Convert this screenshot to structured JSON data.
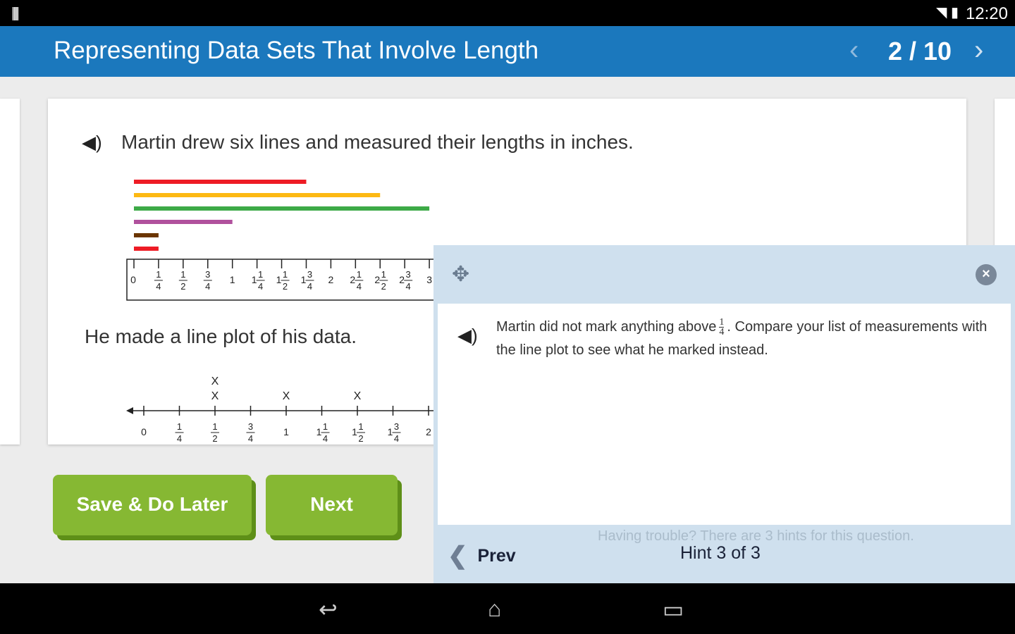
{
  "status": {
    "time": "12:20"
  },
  "header": {
    "title": "Representing Data Sets That Involve Length",
    "pager": "2 / 10"
  },
  "question": {
    "text": "Martin drew six lines and measured their lengths in inches.",
    "plot_text": "He made a line plot of his data."
  },
  "lines": [
    {
      "color": "#ee1c25",
      "length": 1.75
    },
    {
      "color": "#fdb913",
      "length": 2.5
    },
    {
      "color": "#3daa47",
      "length": 3
    },
    {
      "color": "#b0519d",
      "length": 1
    },
    {
      "color": "#6b3500",
      "length": 0.25
    },
    {
      "color": "#ee1c25",
      "length": 0.25
    }
  ],
  "ruler_labels": [
    [
      "0"
    ],
    [
      "",
      "1",
      "4"
    ],
    [
      "",
      "1",
      "2"
    ],
    [
      "",
      "3",
      "4"
    ],
    [
      "1"
    ],
    [
      "1",
      "1",
      "4"
    ],
    [
      "1",
      "1",
      "2"
    ],
    [
      "1",
      "3",
      "4"
    ],
    [
      "2"
    ],
    [
      "2",
      "1",
      "4"
    ],
    [
      "2",
      "1",
      "2"
    ],
    [
      "2",
      "3",
      "4"
    ],
    [
      "3"
    ]
  ],
  "plot_labels": [
    [
      "0"
    ],
    [
      "",
      "1",
      "4"
    ],
    [
      "",
      "1",
      "2"
    ],
    [
      "",
      "3",
      "4"
    ],
    [
      "1"
    ],
    [
      "1",
      "1",
      "4"
    ],
    [
      "1",
      "1",
      "2"
    ],
    [
      "1",
      "3",
      "4"
    ],
    [
      "2"
    ]
  ],
  "plot_marks": [
    {
      "value": 0.5,
      "count": 2
    },
    {
      "value": 1,
      "count": 1
    },
    {
      "value": 1.5,
      "count": 1
    }
  ],
  "mark_symbol": "X",
  "buttons": {
    "save": "Save & Do Later",
    "next": "Next"
  },
  "hint": {
    "text_before": "Martin did not mark anything above",
    "frac_num": "1",
    "frac_den": "4",
    "text_after": ". Compare your list of measurements with the line plot to see what he marked instead.",
    "trouble": "Having trouble? There are 3 hints for this question.",
    "counter": "Hint 3 of 3",
    "prev": "Prev"
  }
}
